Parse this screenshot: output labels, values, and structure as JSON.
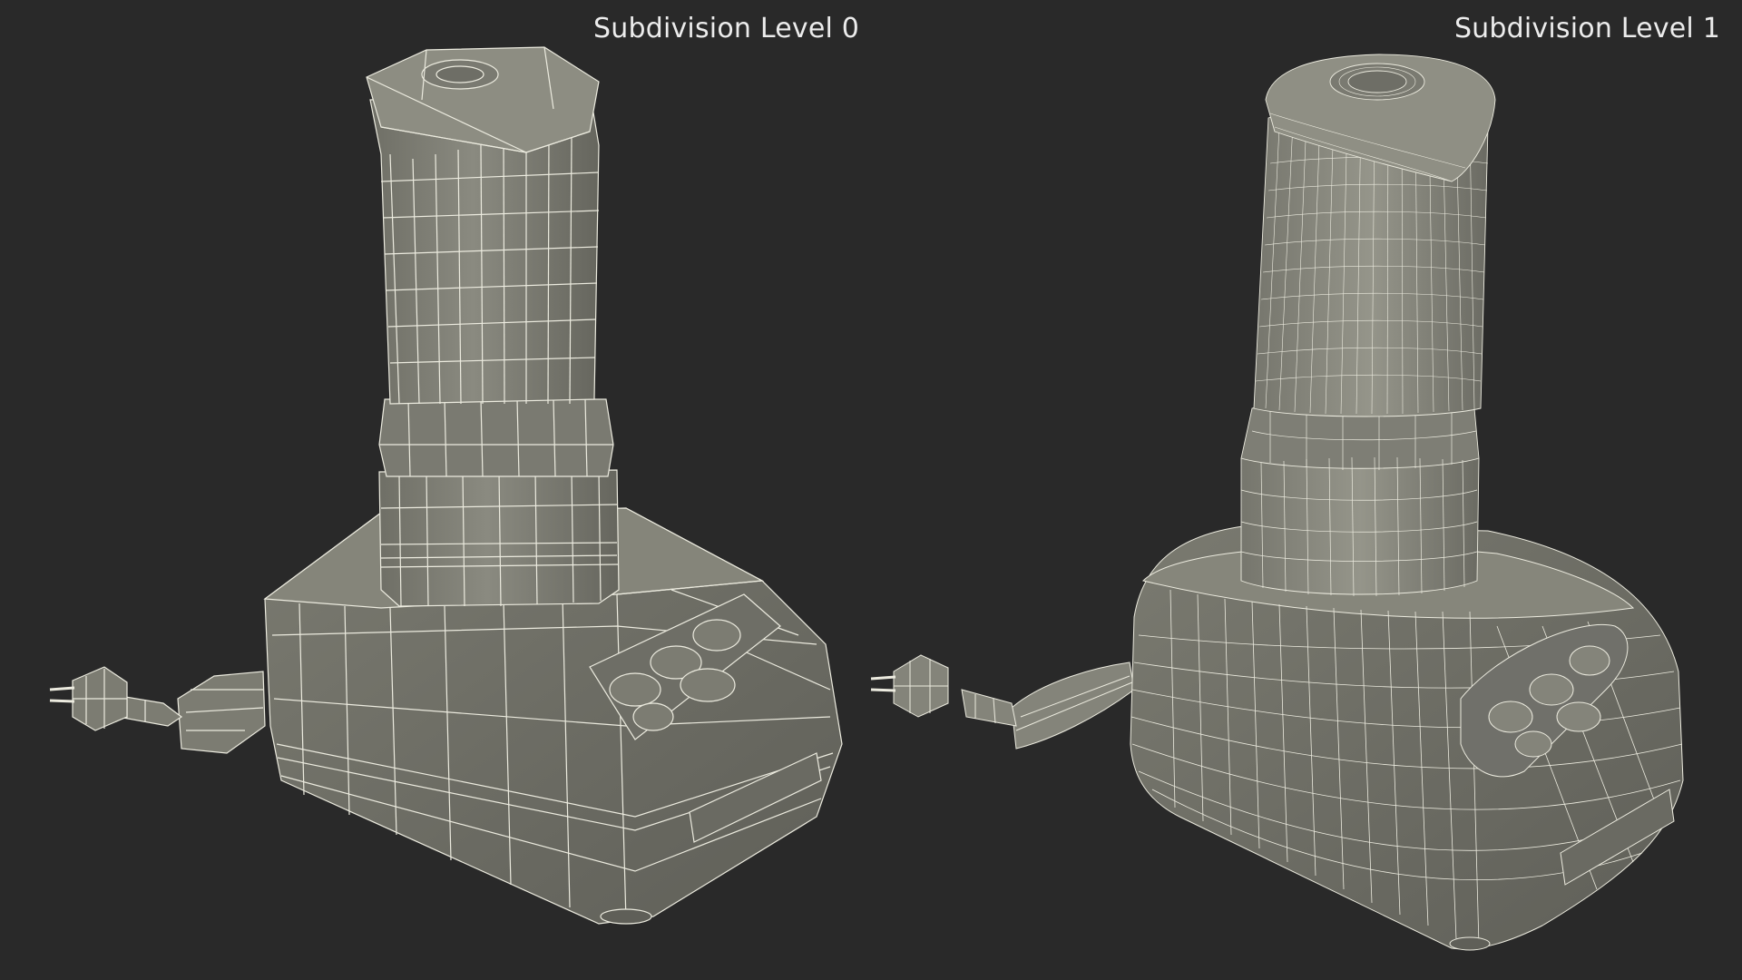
{
  "viewport": {
    "background_color": "#292929",
    "mesh_fill_color": "#7c7c72",
    "wire_color": "#ecebdf"
  },
  "panels": [
    {
      "label": "Subdivision Level 0",
      "object": "blender-wireframe-low-poly"
    },
    {
      "label": "Subdivision Level 1",
      "object": "blender-wireframe-subdivided"
    }
  ]
}
